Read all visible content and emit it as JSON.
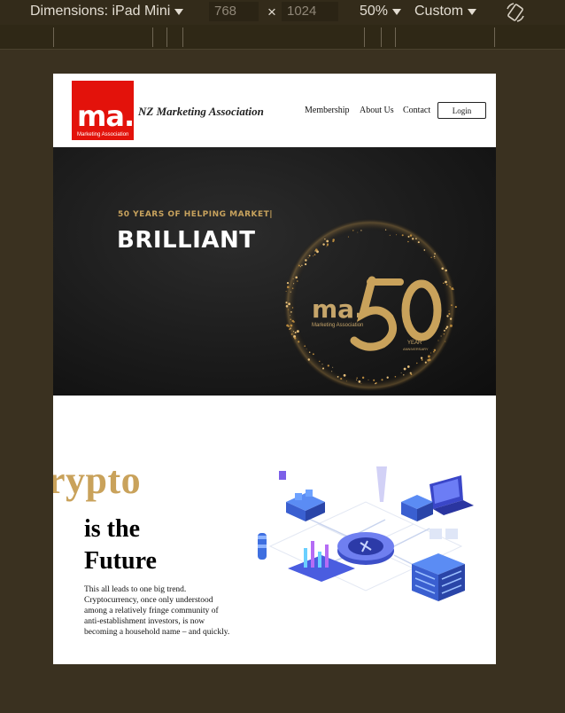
{
  "devtools": {
    "dimensions_label": "Dimensions: iPad Mini",
    "width": "768",
    "times": "×",
    "height": "1024",
    "zoom": "50%",
    "throttle": "Custom"
  },
  "site": {
    "logo_text": "ma.",
    "logo_subtext": "Marketing Association",
    "title": "NZ Marketing Association",
    "nav": [
      "Membership",
      "About Us",
      "Contact"
    ],
    "login_label": "Login"
  },
  "hero": {
    "subtitle": "50 YEARS OF HELPING MARKET|",
    "title": "BRILLIANT",
    "badge_logo": "ma.",
    "badge_logo_sub": "Marketing Association",
    "badge_year": "YEAR",
    "badge_anniversary": "ANNIVERSARY"
  },
  "content": {
    "crypto_word": "rypto",
    "headline_line1": "is the",
    "headline_line2": "Future",
    "body": "This all leads to one big trend. Cryptocurrency, once only understood among a relatively fringe community of anti-establishment investors, is now becoming a household name – and quickly."
  },
  "colors": {
    "brand_red": "#e3120b",
    "gold": "#c9a25b",
    "devtools_bg": "#332b1a"
  }
}
